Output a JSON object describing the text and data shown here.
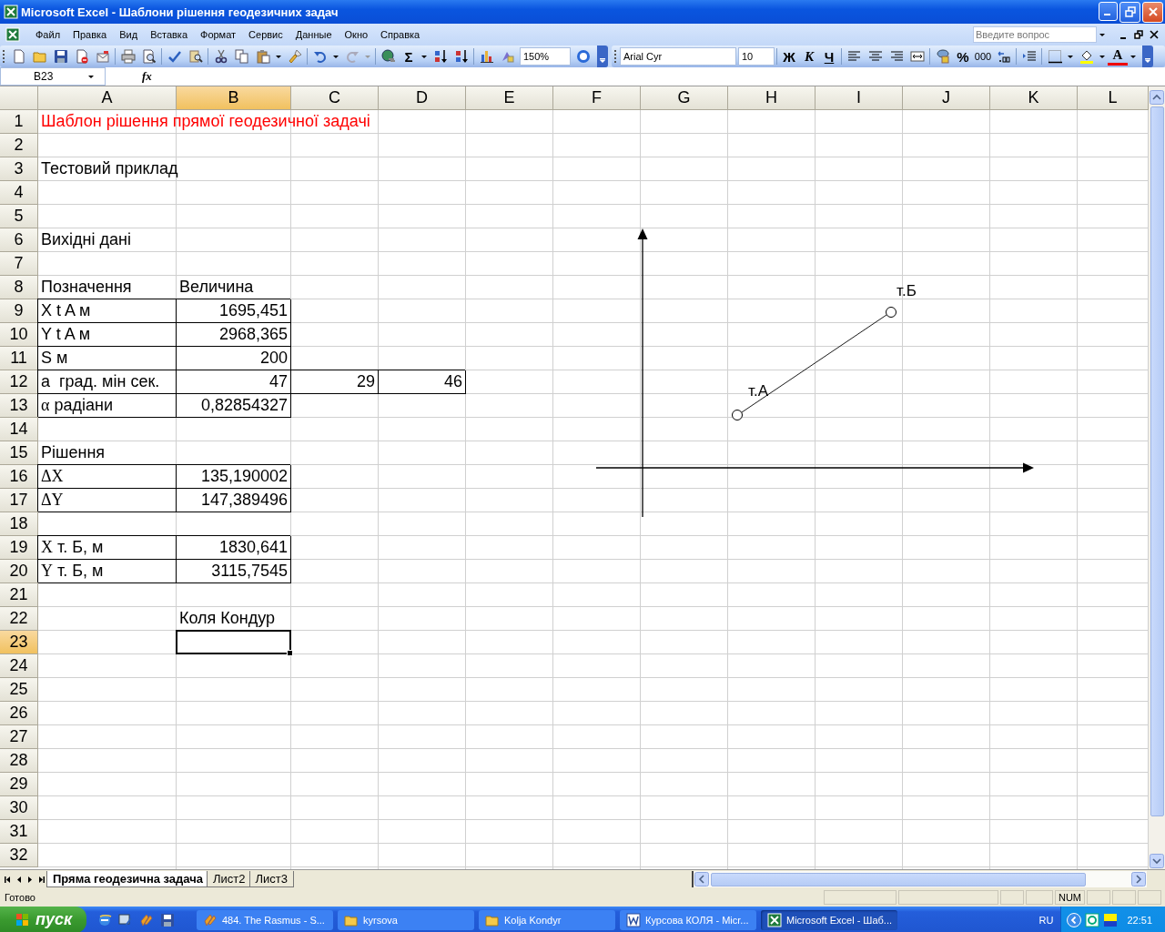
{
  "window": {
    "title": "Microsoft Excel - Шаблони рішення геодезичних задач"
  },
  "menu": [
    {
      "label": "Файл"
    },
    {
      "label": "Правка"
    },
    {
      "label": "Вид"
    },
    {
      "label": "Вставка"
    },
    {
      "label": "Формат"
    },
    {
      "label": "Сервис"
    },
    {
      "label": "Данные"
    },
    {
      "label": "Окно"
    },
    {
      "label": "Справка"
    }
  ],
  "help_box": {
    "placeholder": "Введите вопрос"
  },
  "standard_toolbar": {
    "sum": "Σ",
    "zoom": "150%"
  },
  "formatting_toolbar": {
    "font": "Arial Cyr",
    "size": "10",
    "bold": "Ж",
    "italic": "К",
    "underline": "Ч",
    "percent": "%",
    "thousands": "000",
    "font_color": "A"
  },
  "formula_bar": {
    "name_box": "B23",
    "function_symbol": "fx"
  },
  "sheet": {
    "columns": [
      {
        "label": "A",
        "selected": false
      },
      {
        "label": "B",
        "selected": true
      },
      {
        "label": "C",
        "selected": false
      },
      {
        "label": "D",
        "selected": false
      },
      {
        "label": "E",
        "selected": false
      },
      {
        "label": "F",
        "selected": false
      },
      {
        "label": "G",
        "selected": false
      },
      {
        "label": "H",
        "selected": false
      },
      {
        "label": "I",
        "selected": false
      },
      {
        "label": "J",
        "selected": false
      },
      {
        "label": "K",
        "selected": false
      },
      {
        "label": "L",
        "selected": false
      }
    ],
    "rows": [
      {
        "label": "1",
        "selected": false,
        "cells": [
          {
            "kind": "text",
            "text": "Шаблон рішення прямої геодезичної задачі",
            "color": "#ff0000",
            "bordered": false,
            "selected": false
          }
        ]
      },
      {
        "label": "2",
        "selected": false
      },
      {
        "label": "3",
        "selected": false,
        "cells": [
          {
            "kind": "text",
            "text": "Тестовий приклад",
            "bordered": false,
            "selected": false
          }
        ]
      },
      {
        "label": "4",
        "selected": false
      },
      {
        "label": "5",
        "selected": false
      },
      {
        "label": "6",
        "selected": false,
        "cells": [
          {
            "kind": "text",
            "text": "Вихідні дані",
            "bordered": false,
            "selected": false
          }
        ]
      },
      {
        "label": "7",
        "selected": false
      },
      {
        "label": "8",
        "selected": false,
        "cells": [
          {
            "kind": "text",
            "text": "Позначення",
            "bordered": false,
            "selected": false
          },
          {
            "kind": "text",
            "text": "Величина",
            "bordered": false,
            "selected": false
          }
        ]
      },
      {
        "label": "9",
        "selected": false,
        "cells": [
          {
            "kind": "text",
            "text": "X t A м",
            "bordered": true,
            "selected": false
          },
          {
            "kind": "number",
            "text": "1695,451",
            "bordered": true,
            "selected": false
          }
        ]
      },
      {
        "label": "10",
        "selected": false,
        "cells": [
          {
            "kind": "text",
            "text": "Y t A м",
            "bordered": true,
            "selected": false
          },
          {
            "kind": "number",
            "text": "2968,365",
            "bordered": true,
            "selected": false
          }
        ]
      },
      {
        "label": "11",
        "selected": false,
        "cells": [
          {
            "kind": "text",
            "text": "S м",
            "bordered": true,
            "selected": false
          },
          {
            "kind": "number",
            "text": "200",
            "bordered": true,
            "selected": false
          }
        ]
      },
      {
        "label": "12",
        "selected": false,
        "cells": [
          {
            "kind": "text",
            "text": "а  град. мін сек.",
            "bordered": true,
            "selected": false
          },
          {
            "kind": "number",
            "text": "47",
            "bordered": true,
            "selected": false
          },
          {
            "kind": "number",
            "text": "29",
            "bordered": true,
            "selected": false
          },
          {
            "kind": "number",
            "text": "46",
            "bordered": true,
            "selected": false
          }
        ]
      },
      {
        "label": "13",
        "selected": false,
        "cells": [
          {
            "kind": "text",
            "symbol": "α",
            "text": "радіани",
            "bordered": true,
            "selected": false
          },
          {
            "kind": "number",
            "text": "0,82854327",
            "bordered": true,
            "selected": false
          }
        ]
      },
      {
        "label": "14",
        "selected": false
      },
      {
        "label": "15",
        "selected": false,
        "cells": [
          {
            "kind": "text",
            "text": "Рішення",
            "bordered": false,
            "selected": false
          }
        ]
      },
      {
        "label": "16",
        "selected": false,
        "cells": [
          {
            "kind": "text",
            "symbol": "ΔX",
            "bordered": true,
            "selected": false
          },
          {
            "kind": "number",
            "text": "135,190002",
            "bordered": true,
            "selected": false
          }
        ]
      },
      {
        "label": "17",
        "selected": false,
        "cells": [
          {
            "kind": "text",
            "symbol": "ΔY",
            "bordered": true,
            "selected": false
          },
          {
            "kind": "number",
            "text": "147,389496",
            "bordered": true,
            "selected": false
          }
        ]
      },
      {
        "label": "18",
        "selected": false
      },
      {
        "label": "19",
        "selected": false,
        "cells": [
          {
            "kind": "text",
            "symbol": "X",
            "text": "т. Б, м",
            "bordered": true,
            "selected": false
          },
          {
            "kind": "number",
            "text": "1830,641",
            "bordered": true,
            "selected": false
          }
        ]
      },
      {
        "label": "20",
        "selected": false,
        "cells": [
          {
            "kind": "text",
            "symbol": "Y",
            "text": "т. Б, м",
            "bordered": true,
            "selected": false
          },
          {
            "kind": "number",
            "text": "3115,7545",
            "bordered": true,
            "selected": false
          }
        ]
      },
      {
        "label": "21",
        "selected": false
      },
      {
        "label": "22",
        "selected": false,
        "cells": [
          {
            "bordered": false,
            "selected": false
          },
          {
            "kind": "text",
            "text": "Коля Кондур",
            "bordered": false,
            "selected": false
          }
        ]
      },
      {
        "label": "23",
        "selected": true,
        "cells": [
          {
            "bordered": false,
            "selected": false
          },
          {
            "bordered": false,
            "selected": true
          }
        ]
      },
      {
        "label": "24",
        "selected": false
      },
      {
        "label": "25",
        "selected": false
      },
      {
        "label": "26",
        "selected": false
      },
      {
        "label": "27",
        "selected": false
      },
      {
        "label": "28",
        "selected": false
      },
      {
        "label": "29",
        "selected": false
      },
      {
        "label": "30",
        "selected": false
      },
      {
        "label": "31",
        "selected": false
      },
      {
        "label": "32",
        "selected": false
      }
    ]
  },
  "drawing": {
    "points": [
      {
        "label": "т.Б"
      },
      {
        "label": "т.А"
      }
    ]
  },
  "sheet_tabs": [
    {
      "label": "Пряма геодезична задача",
      "selected": true
    },
    {
      "label": "Лист2",
      "selected": false
    },
    {
      "label": "Лист3",
      "selected": false
    }
  ],
  "status_bar": {
    "status": "Готово",
    "indicators": [
      "NUM"
    ]
  },
  "taskbar": {
    "start": "пуск",
    "tasks": [
      {
        "kind": "media",
        "label": "484. The Rasmus - S...",
        "selected": false
      },
      {
        "kind": "folder",
        "label": "kyrsova",
        "selected": false
      },
      {
        "kind": "folder",
        "label": "Kolja Kondyr",
        "selected": false
      },
      {
        "kind": "word",
        "label": "Курсова КОЛЯ - Micr...",
        "selected": false
      },
      {
        "kind": "excel",
        "label": "Microsoft Excel - Шаб...",
        "selected": true
      }
    ],
    "language": "RU",
    "clock": "22:51"
  }
}
